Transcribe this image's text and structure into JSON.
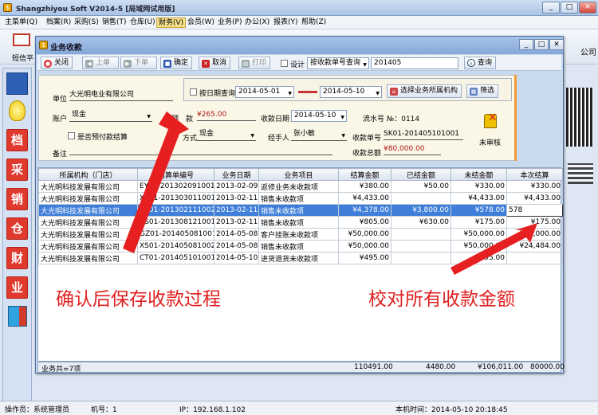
{
  "app": {
    "title": "Shangzhiyou Soft V2014-5 [局域网试用版]"
  },
  "menu": [
    "主菜单(Q)",
    "档案(R)",
    "采购(S)",
    "销售(T)",
    "仓库(U)",
    "财务(V)",
    "会员(W)",
    "业务(P)",
    "办公(X)",
    "报表(Y)",
    "帮助(Z)"
  ],
  "toolbar": {
    "first_label": "短信平",
    "company_partial": "公司"
  },
  "dialog": {
    "title": "业务收款",
    "buttons": {
      "close": "关闭",
      "prev": "上单",
      "next": "下单",
      "confirm": "确定",
      "cancel": "取消",
      "print": "打印",
      "design": "设计"
    },
    "search_mode": "按收款单号查询",
    "search_value": "201405",
    "query": "查询"
  },
  "form": {
    "unit_label": "单位",
    "unit_value": "大光明电业有限公司",
    "date_query_label": "按日期查询",
    "date_from": "2014-05-01",
    "date_to": "2014-05-10",
    "select_org_btn": "选择业务所属机构",
    "filter_btn": "筛选",
    "account_label": "账户",
    "account_value": "现金",
    "prepaid_label": "预",
    "prepaid_label2": "款",
    "prepaid_value": "¥265.00",
    "pay_date_label": "收款日期",
    "pay_date_value": "2014-05-10",
    "serial_label": "流水号 №：0114",
    "prepaid_check_label": "是否预付款结算",
    "method_label": "方式",
    "method_value": "现金",
    "handler_label": "经手人",
    "handler_value": "张小敏",
    "receipt_label": "收款单号",
    "receipt_value": "SK01-201405101001",
    "total_label": "收款总额",
    "total_value": "¥80,000.00",
    "remark_label": "备注",
    "unaudited": "未审核"
  },
  "grid": {
    "headers": [
      "所属机构（门店）",
      "结算单编号",
      "业务日期",
      "业务项目",
      "结算金额",
      "已结金额",
      "未结金额",
      "本次结算"
    ],
    "rows": [
      [
        "大光明科技发展有限公司",
        "EY01-201302091001",
        "2013-02-09",
        "返修业务未收款项",
        "¥380.00",
        "¥50.00",
        "¥330.00",
        "¥330.00"
      ],
      [
        "大光明科技发展有限公司",
        "XS01-201303011001",
        "2013-02-11",
        "销售未收款项",
        "¥4,433.00",
        "",
        "¥4,433.00",
        "¥4,433.00"
      ],
      [
        "大光明科技发展有限公司",
        "XS01-201302111002",
        "2013-02-11",
        "销售未收款项",
        "¥4,378.00",
        "¥3,800.00",
        "¥578.00",
        "578"
      ],
      [
        "大光明科技发展有限公司",
        "XS01-201308121001",
        "2013-02-11",
        "销售未收款项",
        "¥805.00",
        "¥630.00",
        "¥175.00",
        "¥175.00"
      ],
      [
        "大光明科技发展有限公司",
        "GZ01-201405081001",
        "2014-05-08",
        "客户挂账未收款项",
        "¥50,000.00",
        "",
        "¥50,000.00",
        "¥50,000.00"
      ],
      [
        "大光明科技发展有限公司",
        "XS01-201405081002",
        "2014-05-08",
        "销售未收款项",
        "¥50,000.00",
        "",
        "¥50,000.00",
        "¥24,484.00"
      ],
      [
        "大光明科技发展有限公司",
        "CT01-201405101001",
        "2014-05-10",
        "进货退货未收款项",
        "¥495.00",
        "",
        "¥495.00",
        ""
      ]
    ],
    "footer": {
      "count": "业务共=7项",
      "total_amount": "110491.00",
      "settled": "4480.00",
      "unsettled": "¥106,011.00",
      "this_time": "80000.00"
    }
  },
  "annotations": {
    "left": "确认后保存收款过程",
    "right": "校对所有收款金额"
  },
  "status": {
    "operator": "操作员：系统管理员",
    "machine": "机号：1",
    "ip": "IP：192.168.1.102",
    "time": "本机时间：2014-05-10 20:18:45"
  },
  "sidebar_icons": [
    "档",
    "采",
    "销",
    "仓",
    "财",
    "业"
  ]
}
